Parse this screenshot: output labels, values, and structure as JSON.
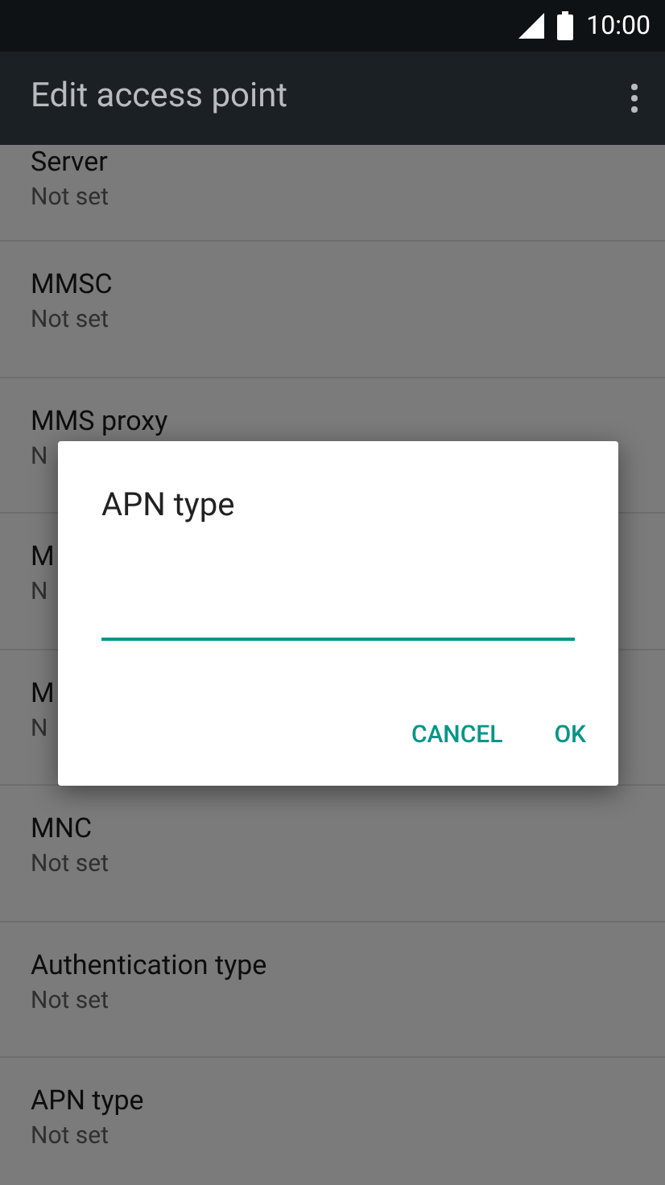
{
  "status_bar": {
    "time": "10:00"
  },
  "app_bar": {
    "title": "Edit access point"
  },
  "settings": [
    {
      "title": "Server",
      "subtitle": "Not set"
    },
    {
      "title": "MMSC",
      "subtitle": "Not set"
    },
    {
      "title": "MMS proxy",
      "subtitle": "N"
    },
    {
      "title": "M",
      "subtitle": "N"
    },
    {
      "title": "M",
      "subtitle": "N"
    },
    {
      "title": "MNC",
      "subtitle": "Not set"
    },
    {
      "title": "Authentication type",
      "subtitle": "Not set"
    },
    {
      "title": "APN type",
      "subtitle": "Not set"
    }
  ],
  "dialog": {
    "title": "APN type",
    "buttons": [
      "CANCEL",
      "OK"
    ]
  }
}
